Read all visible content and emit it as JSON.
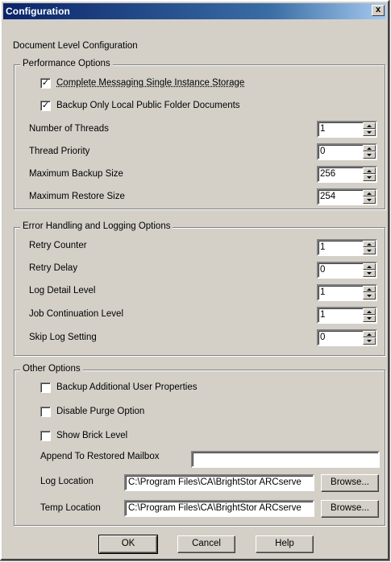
{
  "window": {
    "title": "Configuration",
    "close_glyph": "x"
  },
  "heading": "Document Level Configuration",
  "performance": {
    "title": "Performance Options",
    "checks": [
      {
        "label": "Complete Messaging Single Instance Storage",
        "checked": true
      },
      {
        "label": "Backup Only Local Public Folder Documents",
        "checked": true
      }
    ],
    "fields": [
      {
        "label": "Number of Threads",
        "value": "1"
      },
      {
        "label": "Thread Priority",
        "value": "0"
      },
      {
        "label": "Maximum Backup Size",
        "value": "256"
      },
      {
        "label": "Maximum Restore Size",
        "value": "254"
      }
    ]
  },
  "error": {
    "title": "Error Handling and Logging Options",
    "fields": [
      {
        "label": "Retry Counter",
        "value": "1"
      },
      {
        "label": "Retry Delay",
        "value": "0"
      },
      {
        "label": "Log Detail Level",
        "value": "1"
      },
      {
        "label": "Job Continuation Level",
        "value": "1"
      },
      {
        "label": "Skip Log Setting",
        "value": "0"
      }
    ]
  },
  "other": {
    "title": "Other Options",
    "checks": [
      {
        "label": "Backup Additional User Properties",
        "checked": false
      },
      {
        "label": "Disable Purge Option",
        "checked": false
      },
      {
        "label": "Show Brick Level",
        "checked": false
      }
    ],
    "append_label": "Append To Restored Mailbox",
    "append_value": "",
    "log_label": "Log Location",
    "log_value": "C:\\Program Files\\CA\\BrightStor ARCserve",
    "temp_label": "Temp Location",
    "temp_value": "C:\\Program Files\\CA\\BrightStor ARCserve",
    "browse_label": "Browse..."
  },
  "buttons": {
    "ok": "OK",
    "cancel": "Cancel",
    "help": "Help"
  },
  "checkmark_glyph": "✓",
  "colors": {
    "face": "#d4d0c8",
    "title_start": "#0a246a",
    "title_end": "#a6caf0"
  }
}
